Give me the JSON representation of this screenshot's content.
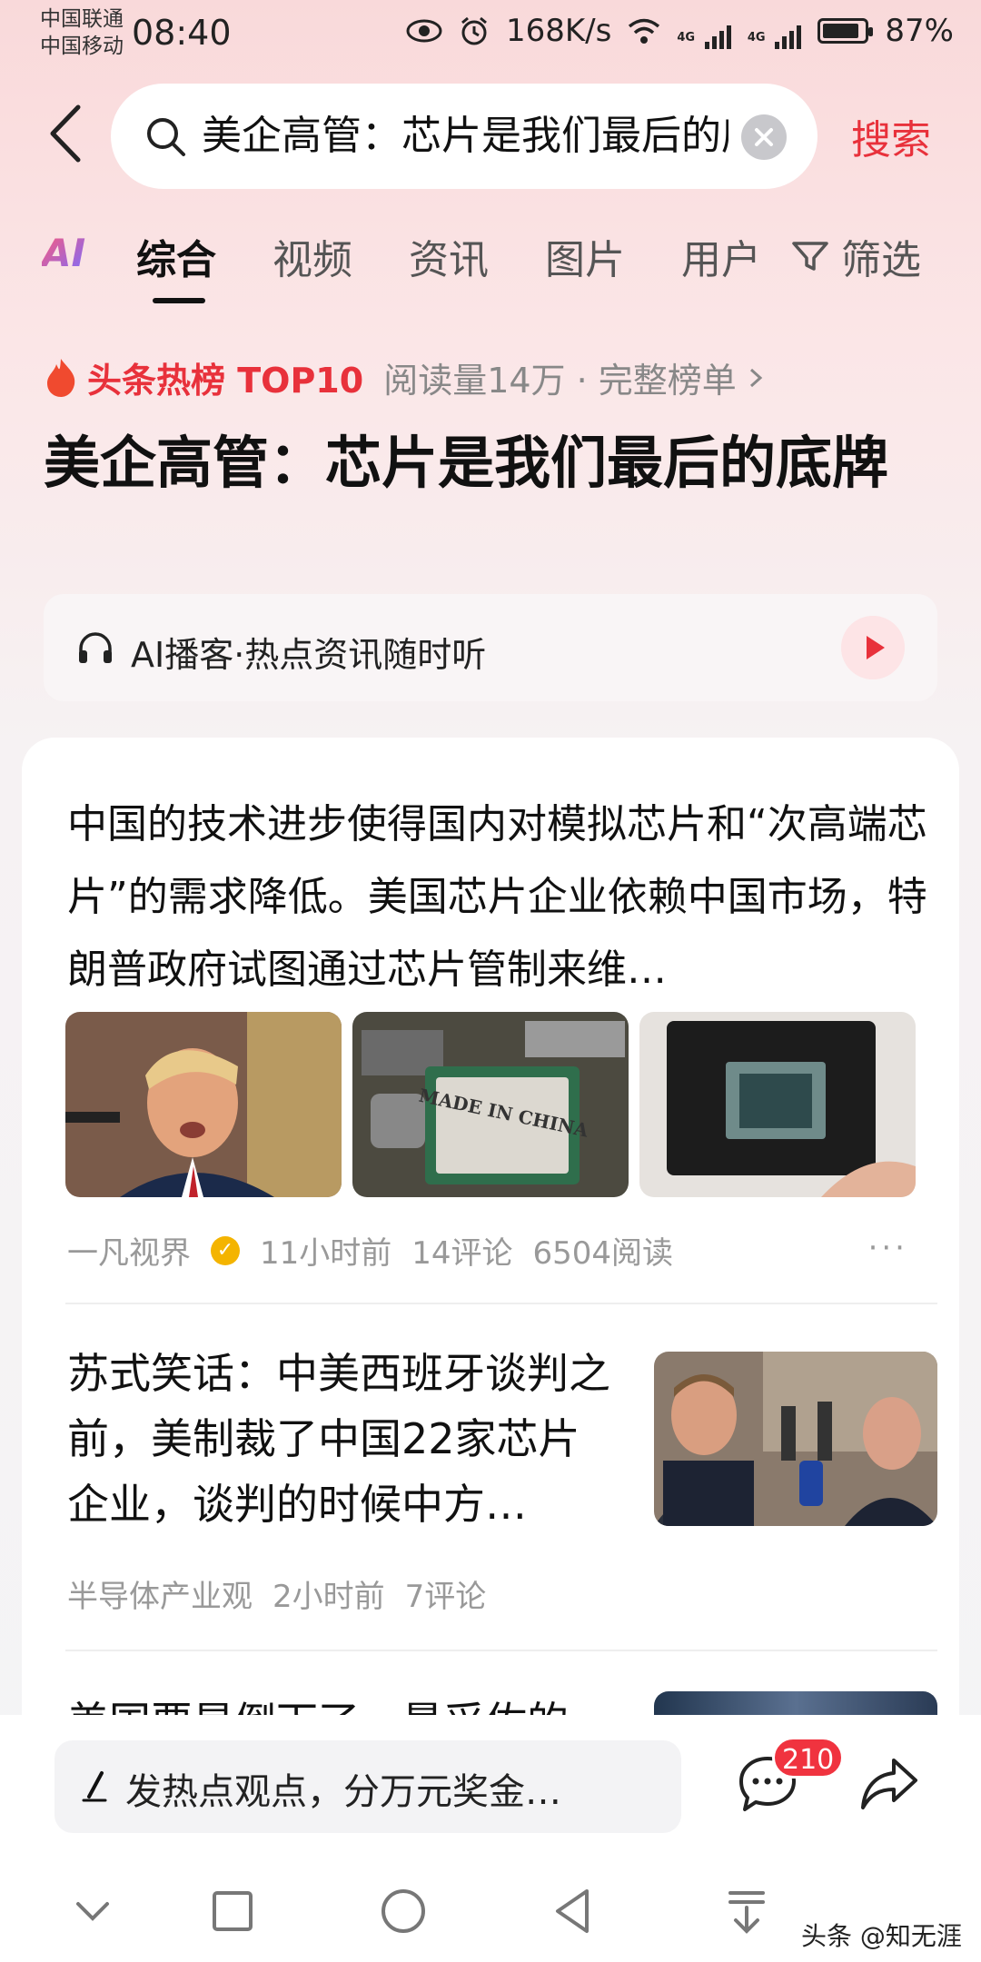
{
  "status_bar": {
    "carrier_1": "中国联通",
    "carrier_2": "中国移动",
    "time": "08:40",
    "net_speed": "168K/s",
    "signal_1": "4G",
    "signal_2": "4G",
    "battery": "87%",
    "battery_level": 0.87
  },
  "search": {
    "query": "美企高管：芯片是我们最后的底牌",
    "submit_label": "搜索"
  },
  "tabs": {
    "ai_label": "AI",
    "items": [
      "综合",
      "视频",
      "资讯",
      "图片",
      "用户"
    ],
    "active_index": 0,
    "filter_label": "筛选"
  },
  "hot": {
    "title": "头条热榜 TOP10",
    "meta": "阅读量14万 · 完整榜单"
  },
  "headline": "美企高管：芯片是我们最后的底牌",
  "podcast": {
    "label": "AI播客·热点资讯随时听"
  },
  "articles": [
    {
      "text": "中国的技术进步使得国内对模拟芯片和“次高端芯片”的需求降低。美国芯片企业依赖中国市场，特朗普政府试图通过芯片管制来维…",
      "author": "一凡视界",
      "time": "11小时前",
      "comments": "14评论",
      "reads": "6504阅读",
      "more": "···",
      "image_2_caption": "MADE IN CHINA"
    },
    {
      "text": "苏式笑话：中美西班牙谈判之前，美制裁了中国22家芯片企业，谈判的时候中方…",
      "author": "半导体产业观",
      "time": "2小时前",
      "comments": "7评论"
    },
    {
      "text": "美国要是倒下了，最采佐的"
    }
  ],
  "bottom": {
    "comment_placeholder": "发热点观点，分万元奖金…",
    "comment_count": "210",
    "watermark": "头条 @知无涯"
  },
  "colors": {
    "accent": "#e8313b",
    "badge": "#f0333f",
    "verified": "#f4b400"
  }
}
